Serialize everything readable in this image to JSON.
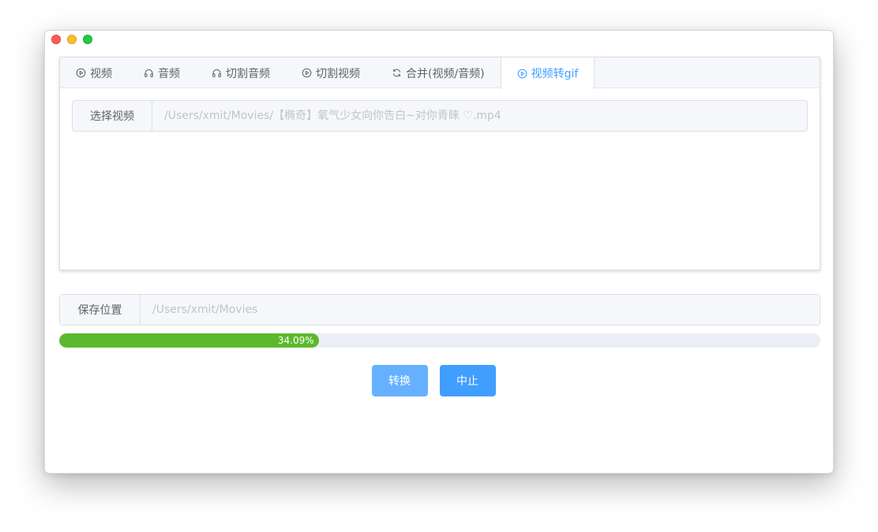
{
  "tabs": [
    {
      "label": "视频",
      "icon": "play-circle-icon"
    },
    {
      "label": "音频",
      "icon": "headphones-icon"
    },
    {
      "label": "切割音频",
      "icon": "headphones-icon"
    },
    {
      "label": "切割视频",
      "icon": "play-circle-icon"
    },
    {
      "label": "合并(视频/音频)",
      "icon": "refresh-icon"
    },
    {
      "label": "视频转gif",
      "icon": "play-circle-icon",
      "active": true
    }
  ],
  "select_video": {
    "label": "选择视频",
    "placeholder": "/Users/xmit/Movies/【椭奇】氧气少女向你告白~对你青睐 ♡.mp4"
  },
  "save_location": {
    "label": "保存位置",
    "placeholder": "/Users/xmit/Movies"
  },
  "progress": {
    "percent": 34.09,
    "label": "34.09%",
    "color": "#5cb82d"
  },
  "buttons": {
    "convert": "转换",
    "stop": "中止"
  },
  "colors": {
    "accent": "#409eff",
    "accent_light": "#66b1ff"
  }
}
